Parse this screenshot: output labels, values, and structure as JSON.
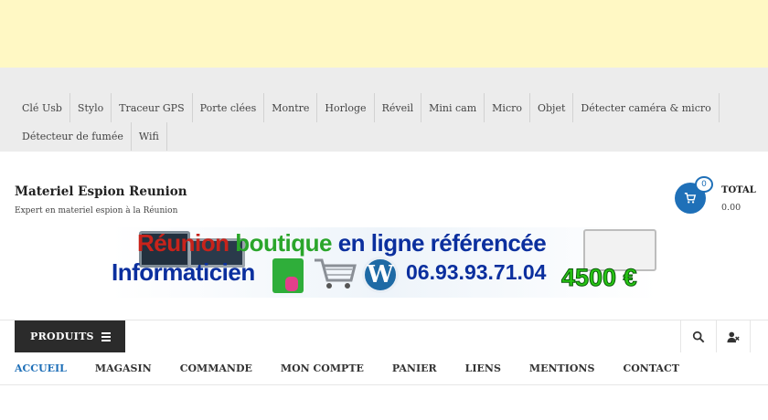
{
  "categories": {
    "row1": [
      "Clé Usb",
      "Stylo",
      "Traceur GPS",
      "Porte clées",
      "Montre",
      "Horloge",
      "Réveil",
      "Mini cam",
      "Micro",
      "Objet",
      "Détecter caméra & micro"
    ],
    "row2": [
      "Détecteur de fumée",
      "Wifi"
    ]
  },
  "site": {
    "title": "Materiel Espion Reunion",
    "tagline": "Expert en materiel espion à la Réunion"
  },
  "cart": {
    "count": "0",
    "total_label": "TOTAL",
    "total_value": "0.00",
    "icon": "shopping-cart-icon"
  },
  "banner": {
    "line1_part1": "Réunion",
    "line1_part2": " boutique",
    "line1_part3": " en ligne référencée",
    "line2": "Informaticien",
    "phone": "06.93.93.71.04",
    "price": "4500 €",
    "wp_glyph": "W"
  },
  "nav": {
    "produits_label": "PRODUITS",
    "menu": [
      "ACCUEIL",
      "MAGASIN",
      "COMMANDE",
      "MON COMPTE",
      "PANIER",
      "LIENS",
      "MENTIONS",
      "CONTACT"
    ],
    "active_index": 0
  },
  "colors": {
    "top_banner": "#fff8c4",
    "accent": "#1f70b8",
    "dark_button": "#2b2b2b"
  }
}
